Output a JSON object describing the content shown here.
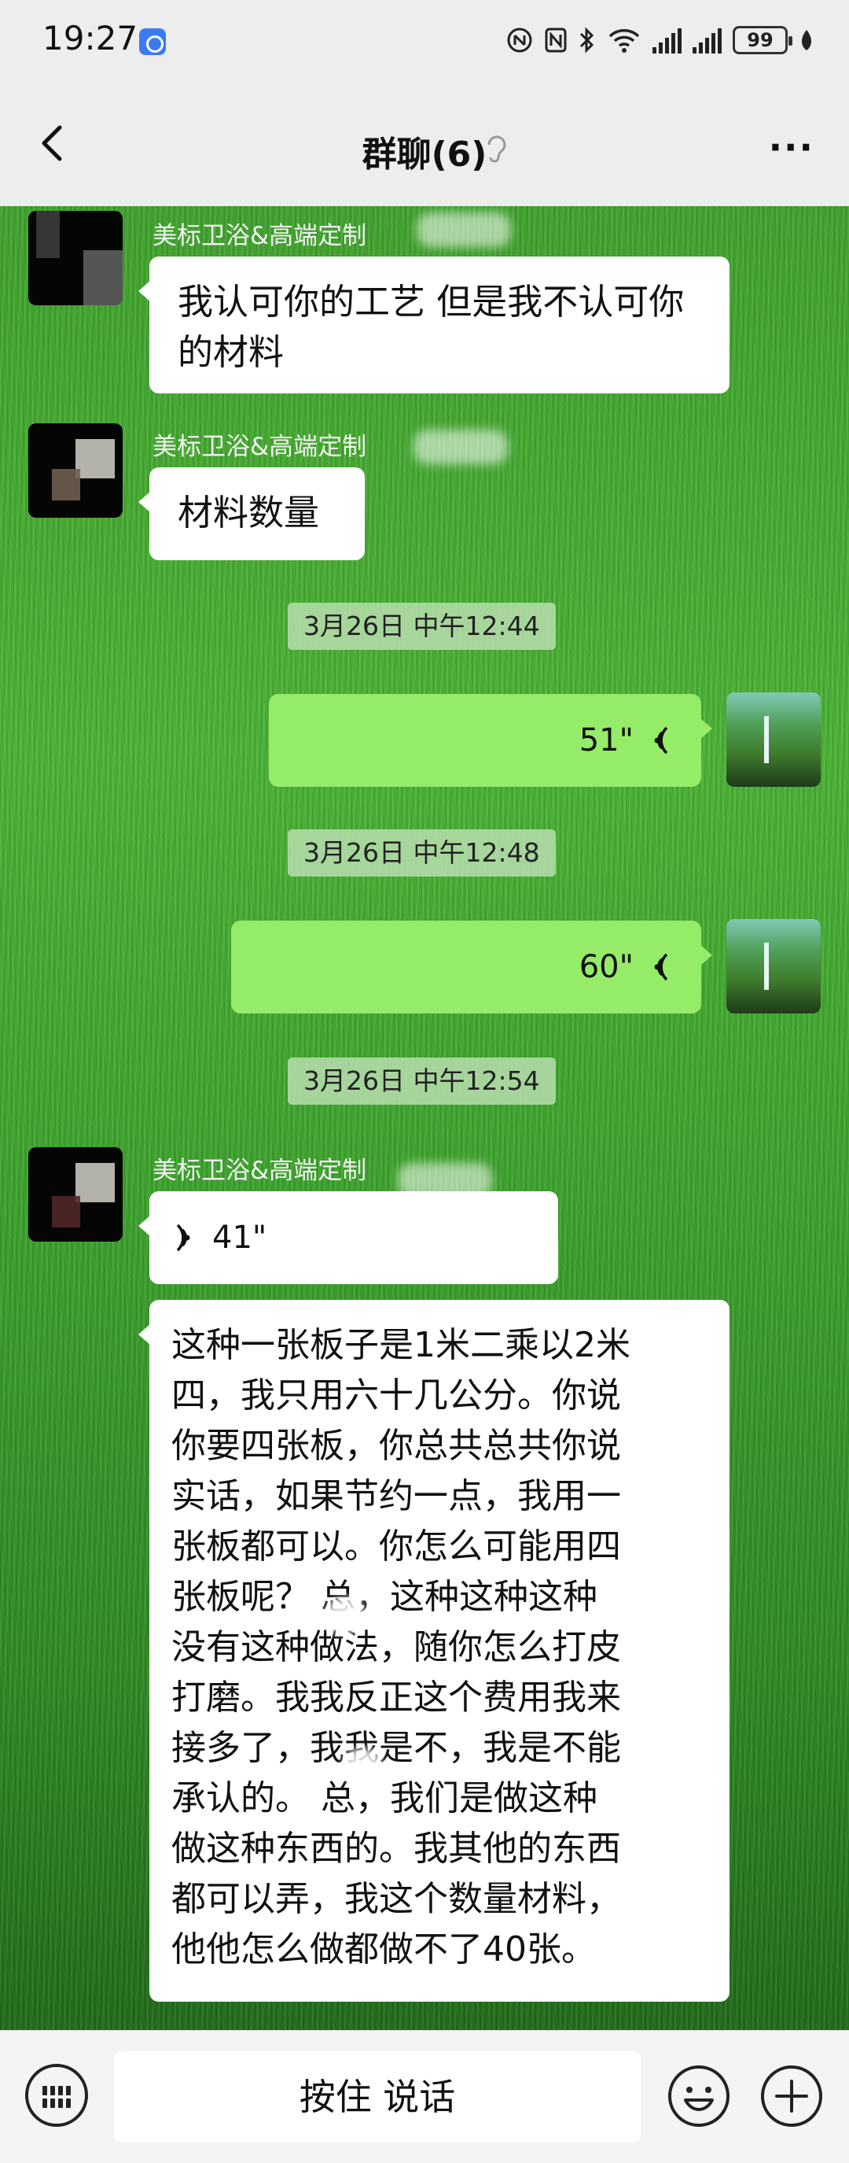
{
  "status_bar": {
    "time": "19:27",
    "battery": "99"
  },
  "header": {
    "title": "群聊(6)"
  },
  "messages": [
    {
      "sender": "美标卫浴&高端定制",
      "text": "我认可你的工艺 但是我不认可你的材料"
    },
    {
      "sender": "美标卫浴&高端定制",
      "text": "材料数量"
    },
    {
      "timestamp": "3月26日 中午12:44"
    },
    {
      "voice_duration": "51\""
    },
    {
      "timestamp": "3月26日 中午12:48"
    },
    {
      "voice_duration": "60\""
    },
    {
      "timestamp": "3月26日 中午12:54"
    },
    {
      "sender": "美标卫浴&高端定制",
      "voice_duration": "41\"",
      "transcript": [
        "这种一张板子是1米二乘以2米",
        "四，我只用六十几公分。你说",
        "你要四张板，你总共总共你说",
        "实话，如果节约一点，我用一",
        "张板都可以。你怎么可能用四",
        "张板呢？  总，这种这种这种",
        "没有这种做法，随你怎么打皮",
        "打磨。我我反正这个费用我来",
        "接多了，我我是不，我是不能",
        "承认的。  总，我们是做这种",
        "做这种东西的。我其他的东西",
        "都可以弄，我这个数量材料，",
        "他他怎么做都做不了40张。"
      ]
    }
  ],
  "input_bar": {
    "hold_to_talk": "按住 说话"
  },
  "colors": {
    "bubble_self": "#95ec69",
    "bubble_other": "#ffffff",
    "bar_background": "#ededed"
  }
}
